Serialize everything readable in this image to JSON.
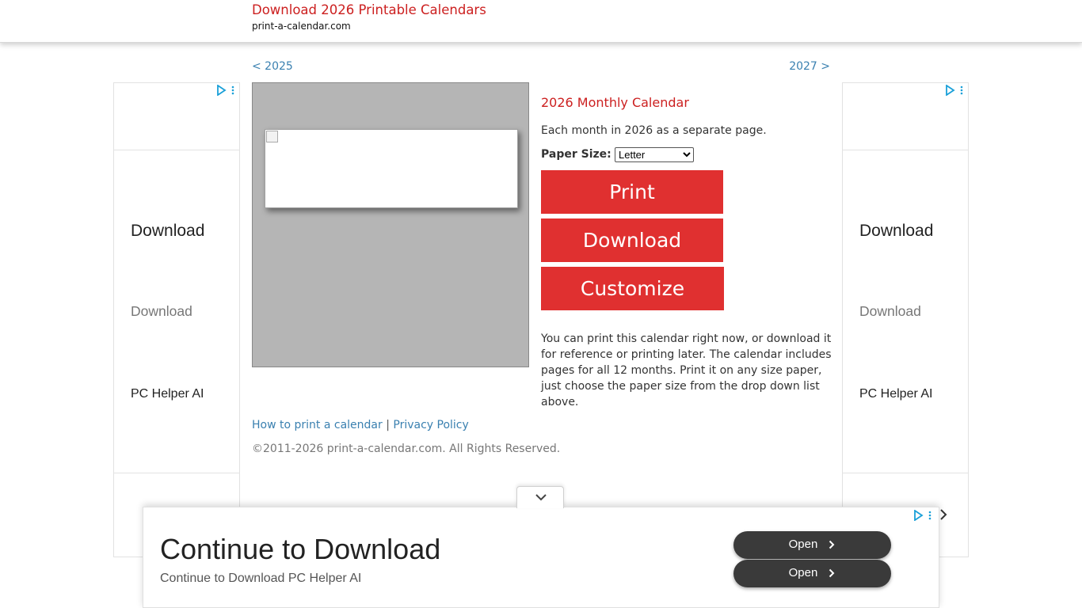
{
  "header": {
    "title": "Download 2026 Printable Calendars",
    "domain": "print-a-calendar.com"
  },
  "nav": {
    "prev_year": "< 2025",
    "next_year": "2027 >"
  },
  "side_ads": {
    "left": {
      "line1": "Download",
      "line2": "Download",
      "line3": "PC Helper AI"
    },
    "right": {
      "line1": "Download",
      "line2": "Download",
      "line3": "PC Helper AI"
    }
  },
  "calendar": {
    "title": "2026 Monthly Calendar",
    "description": "Each month in 2026 as a separate page.",
    "paper_size_label": "Paper Size:",
    "paper_size_value": "Letter",
    "print_label": "Print",
    "download_label": "Download",
    "customize_label": "Customize",
    "info": "You can print this calendar right now, or download it for reference or printing later. The calendar includes pages for all 12 months. Print it on any size paper, just choose the paper size from the drop down list above."
  },
  "footer": {
    "how_to_print": "How to print a calendar",
    "separator": "|",
    "privacy": "Privacy Policy",
    "copyright": "©2011-2026 print-a-calendar.com. All Rights Reserved."
  },
  "bottom_ad": {
    "headline": "Continue to Download",
    "subtext": "Continue to Download PC Helper AI",
    "open_label_1": "Open",
    "open_label_2": "Open"
  },
  "icons": {
    "ad_choice": "ad-choices-icon",
    "ad_menu": "ad-menu-dots-icon",
    "collapse": "chevron-down-icon",
    "open_arrow": "chevron-right-icon",
    "broken_image": "broken-image-icon"
  },
  "colors": {
    "accent_red": "#e03030",
    "title_red": "#cc2020",
    "link_blue": "#3a80b0",
    "preview_gray": "#b5b5b5",
    "open_button": "#3a3a3a"
  }
}
